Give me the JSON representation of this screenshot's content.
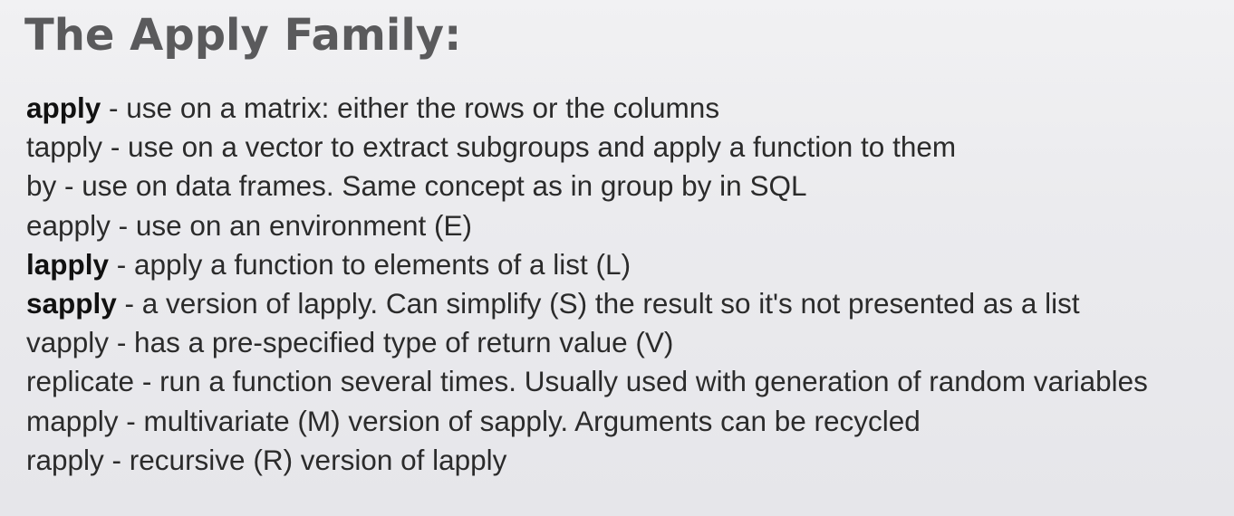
{
  "slide": {
    "title": "The Apply Family:",
    "items": [
      {
        "term": "apply",
        "bold": true,
        "description": " - use on a matrix: either the rows or the columns"
      },
      {
        "term": "tapply",
        "bold": false,
        "description": " - use on a vector to extract subgroups and apply a function to them"
      },
      {
        "term": "by",
        "bold": false,
        "description": " - use on data frames. Same concept as in group by in SQL"
      },
      {
        "term": "eapply",
        "bold": false,
        "description": " - use on an environment (E)"
      },
      {
        "term": "lapply",
        "bold": true,
        "description": " - apply a function to elements of a list (L)"
      },
      {
        "term": "sapply",
        "bold": true,
        "description": " - a version of lapply. Can simplify (S) the result so it's not presented as a list"
      },
      {
        "term": "vapply",
        "bold": false,
        "description": " - has a pre-specified type of return value (V)"
      },
      {
        "term": "replicate",
        "bold": false,
        "description": " - run a function several times. Usually used with generation of random variables"
      },
      {
        "term": "mapply",
        "bold": false,
        "description": " - multivariate (M) version of sapply. Arguments can be recycled"
      },
      {
        "term": "rapply",
        "bold": false,
        "description": " - recursive (R) version of lapply"
      }
    ]
  }
}
